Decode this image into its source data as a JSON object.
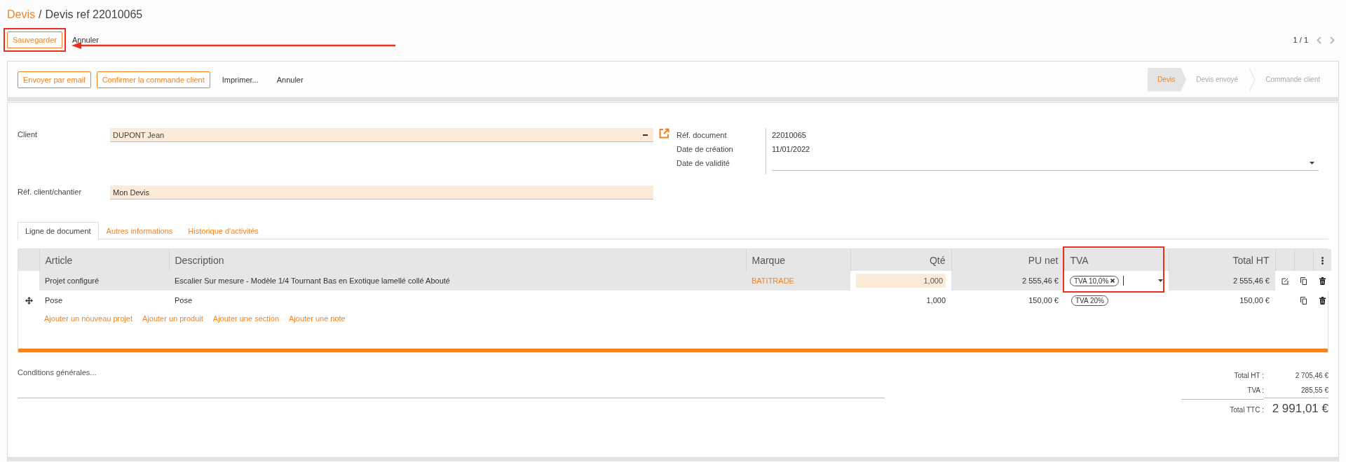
{
  "breadcrumb": {
    "items": [
      {
        "label": "Devis",
        "kind": "link"
      },
      {
        "label": "Devis ref 22010065",
        "kind": "current"
      }
    ],
    "separator": "/"
  },
  "top_actions": [
    {
      "label": "Sauvegarder",
      "kind": "outline"
    },
    {
      "label": "Annuler",
      "kind": "link"
    }
  ],
  "pager": {
    "text": "1 / 1"
  },
  "action_bar": {
    "buttons": [
      {
        "label": "Envoyer par email",
        "kind": "outline"
      },
      {
        "label": "Confirmer la commande client",
        "kind": "outline"
      },
      {
        "label": "Imprimer...",
        "kind": "link"
      },
      {
        "label": "Annuler",
        "kind": "link"
      }
    ],
    "status_steps": [
      {
        "label": "Devis",
        "selected": true
      },
      {
        "label": "Devis envoyé",
        "selected": false
      },
      {
        "label": "Commande client",
        "selected": false
      }
    ]
  },
  "form": {
    "client": {
      "label": "Client",
      "value": "DUPONT Jean"
    },
    "reference": {
      "label": "Réf. client/chantier",
      "value": "Mon Devis"
    },
    "info": [
      {
        "label": "Réf. document",
        "value": "22010065",
        "kind": "text"
      },
      {
        "label": "Date de création",
        "value": "11/01/2022",
        "kind": "text"
      },
      {
        "label": "Date de validité",
        "kind": "date"
      }
    ]
  },
  "tabs": [
    {
      "label": "Ligne de document",
      "selected": true
    },
    {
      "label": "Autres informations",
      "selected": false
    },
    {
      "label": "Historique d'activités",
      "selected": false
    }
  ],
  "table": {
    "columns": [
      "Article",
      "Description",
      "Marque",
      "Qté",
      "PU net",
      "TVA",
      "Total HT"
    ],
    "rows": [
      {
        "article": "Projet configuré",
        "description": "Escalier Sur mesure - Modèle 1/4 Tournant Bas en Exotique lamellé collé Abouté",
        "brand": "BATITRADE",
        "qty": "1,000",
        "price": "2 555,46 €",
        "tax": "TVA 10,0%",
        "total": "2 555,46 €",
        "editing": true
      },
      {
        "article": "Pose",
        "description": "Pose",
        "qty": "1,000",
        "price": "150,00 €",
        "tax": "TVA 20%",
        "total": "150,00 €",
        "editing": false
      }
    ],
    "add_links": [
      "Ajouter un nouveau projet",
      "Ajouter un produit",
      "Ajouter une section",
      "Ajouter une note"
    ]
  },
  "terms": {
    "placeholder": "Conditions générales..."
  },
  "totals": [
    {
      "label": "Total HT :",
      "value": "2 705,46 €",
      "kind": "sub"
    },
    {
      "label": "TVA :",
      "value": "285,55 €",
      "kind": "sub"
    },
    {
      "label": "Total TTC :",
      "value": "2 991,01 €",
      "kind": "grand"
    }
  ]
}
